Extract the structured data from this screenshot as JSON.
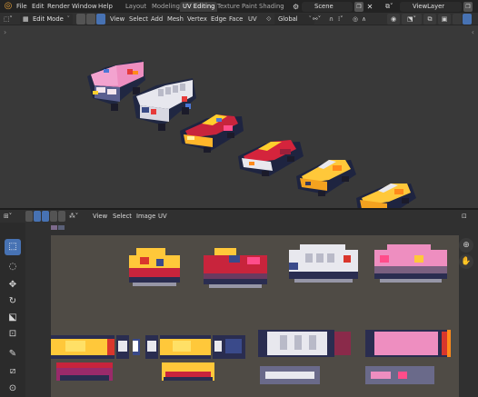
{
  "topbar": {
    "menus": [
      "File",
      "Edit",
      "Render",
      "Window",
      "Help"
    ],
    "workspaces": [
      "Layout",
      "Modeling",
      "UV Editing",
      "Texture Paint",
      "Shading"
    ],
    "active_workspace": "UV Editing",
    "scene": "Scene",
    "view_layer": "ViewLayer"
  },
  "viewport_header": {
    "mode": "Edit Mode",
    "menus": [
      "View",
      "Select",
      "Add",
      "Mesh",
      "Vertex",
      "Edge",
      "Face",
      "UV"
    ],
    "transform_orientation": "Global"
  },
  "uv_header": {
    "menus": [
      "View",
      "Select",
      "Image",
      "UV"
    ]
  },
  "colors": {
    "accent": "#4772b3",
    "viewport_bg": "#393939",
    "uv_bg": "#4f4b45",
    "logo": "#e6a13a"
  },
  "icons": {
    "logo": "blender-logo-icon",
    "tools": [
      "select-box-icon",
      "cursor-icon",
      "move-icon",
      "rotate-icon",
      "scale-icon",
      "transform-icon",
      "annotate-icon",
      "rip-icon",
      "grab-icon"
    ]
  }
}
